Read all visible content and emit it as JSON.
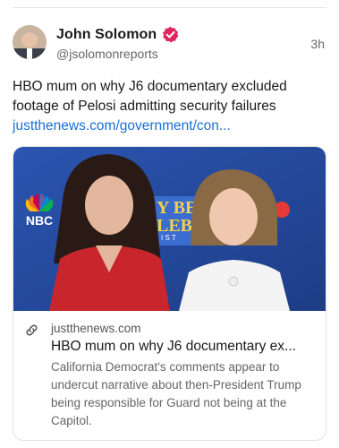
{
  "post": {
    "author_name": "John Solomon",
    "handle": "@jsolomonreports",
    "time": "3h",
    "text": "HBO mum on why J6 documentary excluded footage of Pelosi admitting security failures",
    "link_text": "justthenews.com/government/con..."
  },
  "card": {
    "image_logo_text": "NBC",
    "image_banner_text": "Y BE\nLEB\n I S T",
    "domain": "justthenews.com",
    "title": "HBO mum on why J6 documentary ex...",
    "description": "California Democrat's comments appear to undercut narrative about then-President Trump being responsible for Guard not being at the Capitol."
  },
  "icons": {
    "verified": "verified-badge-icon",
    "link": "link-icon"
  },
  "colors": {
    "verified_badge": "#e0245e",
    "link": "#1a6fd6",
    "image_background": "#2c4f9e",
    "red_jacket": "#c8262c"
  }
}
